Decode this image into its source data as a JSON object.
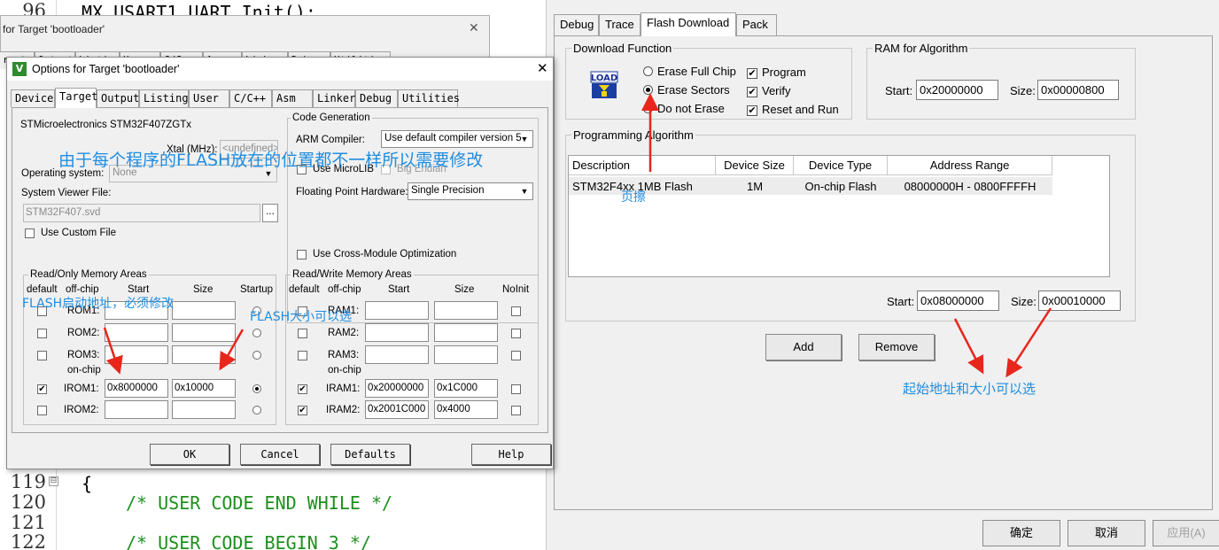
{
  "editor": {
    "lines": [
      {
        "num": "96",
        "code": "MX_USART1_UART_Init();",
        "comment": false
      },
      {
        "num": "119",
        "code": "{",
        "comment": false
      },
      {
        "num": "120",
        "code": "/* USER CODE END WHILE */",
        "comment": true
      },
      {
        "num": "121",
        "code": "",
        "comment": false
      },
      {
        "num": "122",
        "code": "/* USER CODE BEGIN 3 */",
        "comment": true
      }
    ],
    "fold_marker": "⊟"
  },
  "back_dialog": {
    "title": "for Target 'bootloader'",
    "close": "✕",
    "tabs": [
      "rget",
      "Output",
      "Listing",
      "User",
      "C/C++",
      "Asm",
      "Linker",
      "Debug",
      "Utilities"
    ]
  },
  "front_dialog": {
    "title": "Options for Target 'bootloader'",
    "close": "✕",
    "icon_letter": "V",
    "tabs": [
      "Device",
      "Target",
      "Output",
      "Listing",
      "User",
      "C/C++",
      "Asm",
      "Linker",
      "Debug",
      "Utilities"
    ],
    "active_tab": "Target",
    "device_name": "STMicroelectronics STM32F407ZGTx",
    "xtal_label": "Xtal (MHz):",
    "xtal_value": "<undefined>",
    "os_label": "Operating system:",
    "os_value": "None",
    "svd_label": "System Viewer File:",
    "svd_value": "STM32F407.svd",
    "browse": "...",
    "custom_file_label": "Use Custom File",
    "code_gen": {
      "title": "Code Generation",
      "compiler_label": "ARM Compiler:",
      "compiler_value": "Use default compiler version 5",
      "microlib_label": "Use MicroLIB",
      "big_endian_label": "Big Endian",
      "fpu_label": "Floating Point Hardware:",
      "fpu_value": "Single Precision",
      "cross_module_label": "Use Cross-Module Optimization"
    },
    "ro_area": {
      "title": "Read/Only Memory Areas",
      "headers": [
        "default",
        "off-chip",
        "Start",
        "Size",
        "Startup"
      ],
      "offchip_rows": [
        {
          "name": "ROM1:",
          "checked": false,
          "start": "",
          "size": "",
          "startup": false
        },
        {
          "name": "ROM2:",
          "checked": false,
          "start": "",
          "size": "",
          "startup": false
        },
        {
          "name": "ROM3:",
          "checked": false,
          "start": "",
          "size": "",
          "startup": false
        }
      ],
      "onchip_label": "on-chip",
      "onchip_rows": [
        {
          "name": "IROM1:",
          "checked": true,
          "start": "0x8000000",
          "size": "0x10000",
          "startup": true
        },
        {
          "name": "IROM2:",
          "checked": false,
          "start": "",
          "size": "",
          "startup": false
        }
      ]
    },
    "rw_area": {
      "title": "Read/Write Memory Areas",
      "headers": [
        "default",
        "off-chip",
        "Start",
        "Size",
        "NoInit"
      ],
      "offchip_rows": [
        {
          "name": "RAM1:",
          "checked": false,
          "start": "",
          "size": ""
        },
        {
          "name": "RAM2:",
          "checked": false,
          "start": "",
          "size": ""
        },
        {
          "name": "RAM3:",
          "checked": false,
          "start": "",
          "size": ""
        }
      ],
      "onchip_label": "on-chip",
      "onchip_rows": [
        {
          "name": "IRAM1:",
          "checked": true,
          "start": "0x20000000",
          "size": "0x1C000"
        },
        {
          "name": "IRAM2:",
          "checked": true,
          "start": "0x2001C000",
          "size": "0x4000"
        }
      ]
    },
    "buttons": {
      "ok": "OK",
      "cancel": "Cancel",
      "defaults": "Defaults",
      "help": "Help"
    }
  },
  "right_dialog": {
    "tabs": [
      "Debug",
      "Trace",
      "Flash Download",
      "Pack"
    ],
    "active_tab": "Flash Download",
    "download_function": {
      "title": "Download Function",
      "load_icon_text": "LOAD",
      "options": [
        {
          "label": "Erase Full Chip",
          "selected": false
        },
        {
          "label": "Erase Sectors",
          "selected": true
        },
        {
          "label": "Do not Erase",
          "selected": false
        }
      ],
      "checks": [
        {
          "label": "Program",
          "checked": true
        },
        {
          "label": "Verify",
          "checked": true
        },
        {
          "label": "Reset and Run",
          "checked": true
        }
      ]
    },
    "ram_for_algorithm": {
      "title": "RAM for Algorithm",
      "start_label": "Start:",
      "start_value": "0x20000000",
      "size_label": "Size:",
      "size_value": "0x00000800"
    },
    "programming_algorithm": {
      "title": "Programming Algorithm",
      "columns": [
        "Description",
        "Device Size",
        "Device Type",
        "Address Range"
      ],
      "rows": [
        {
          "description": "STM32F4xx 1MB Flash",
          "device_size": "1M",
          "device_type": "On-chip Flash",
          "address_range": "08000000H - 0800FFFFH"
        }
      ],
      "start_label": "Start:",
      "start_value": "0x08000000",
      "size_label": "Size:",
      "size_value": "0x00010000"
    },
    "buttons": {
      "add": "Add",
      "remove": "Remove"
    },
    "footer": {
      "ok": "确定",
      "cancel": "取消",
      "apply": "应用(A)"
    }
  },
  "annotations": {
    "flash_position": "由于每个程序的FLASH放在的位置都不一样所以需要修改",
    "flash_start": "FLASH启动地址，必须修改",
    "flash_size": "FLASH大小可以选",
    "page_erase": "页擦",
    "start_size_selectable": "起始地址和大小可以选",
    "color": "#1f8de0",
    "arrow_color": "#e8261c"
  }
}
